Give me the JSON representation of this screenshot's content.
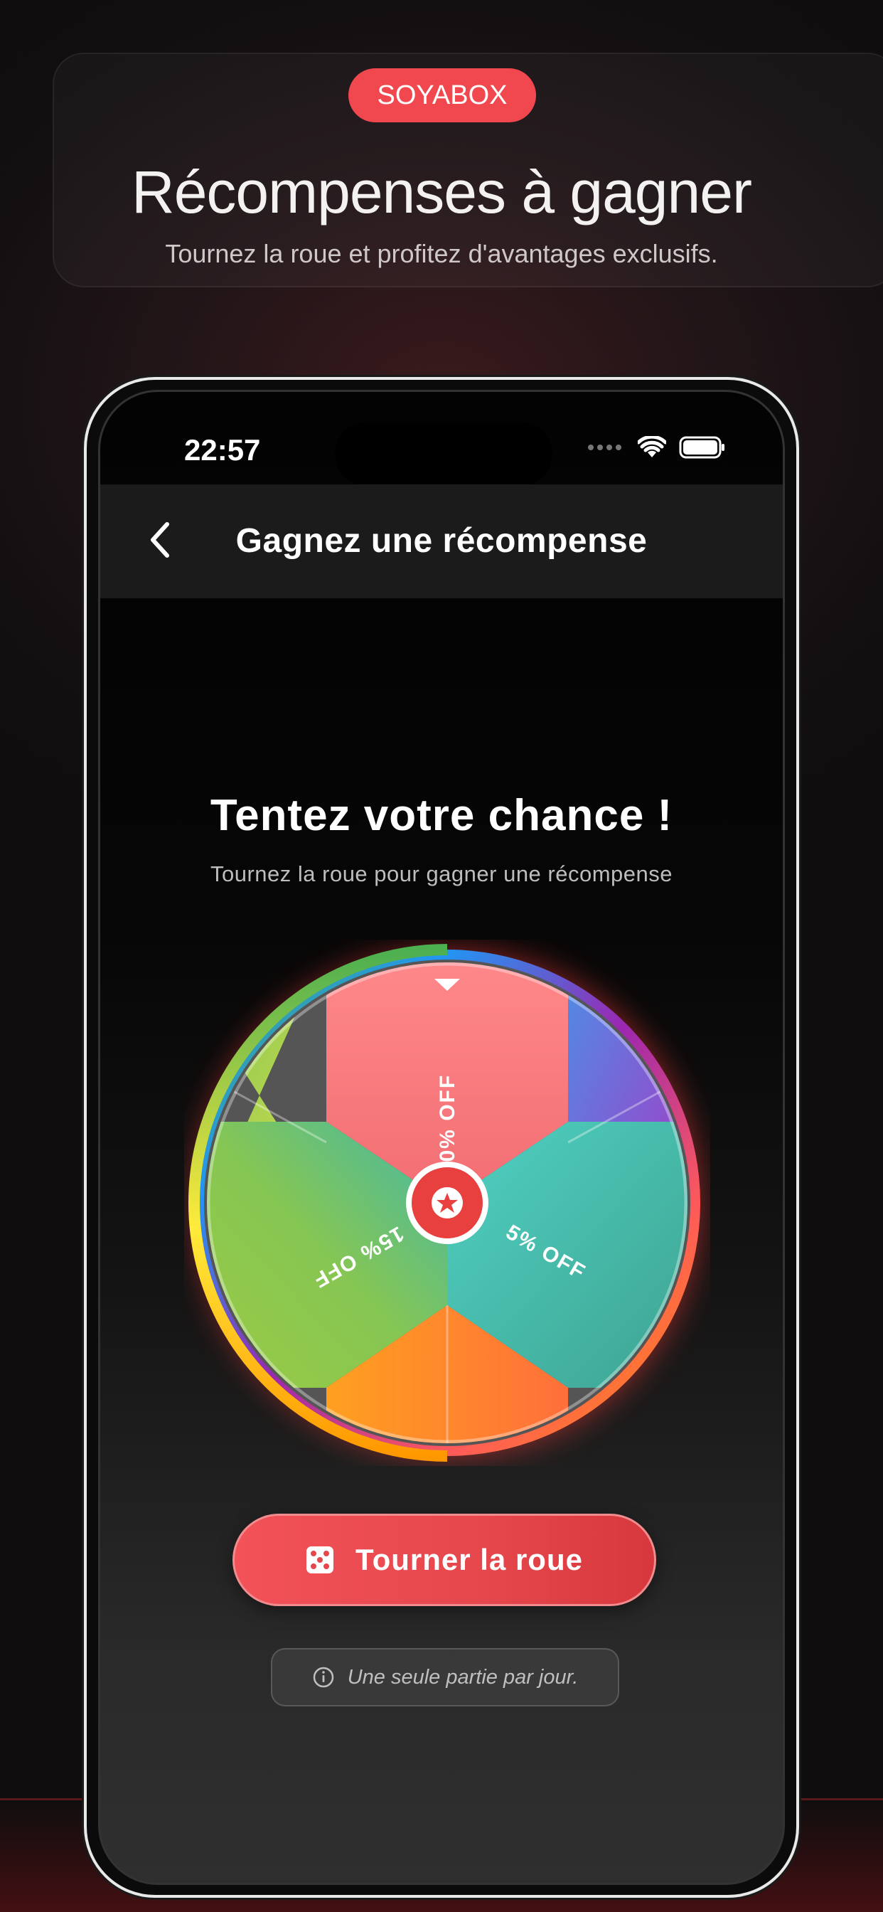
{
  "promo": {
    "brand": "SOYABOX",
    "title": "Récompenses à gagner",
    "subtitle": "Tournez la roue et profitez d'avantages exclusifs."
  },
  "status_bar": {
    "time": "22:57",
    "icons": [
      "signal-icon",
      "wifi-icon",
      "battery-icon"
    ]
  },
  "header": {
    "back_icon": "chevron-left-icon",
    "title": "Gagnez une récompense"
  },
  "game": {
    "title": "Tentez votre chance !",
    "subtitle": "Tournez la roue pour gagner une récompense",
    "wheel": {
      "segments": [
        "10% OFF",
        "5% OFF",
        "15% OFF"
      ],
      "center_icon": "star-icon",
      "pointer_icon": "triangle-down-icon"
    },
    "spin_button": {
      "label": "Tourner la roue",
      "icon": "dice-icon"
    },
    "info": {
      "icon": "info-icon",
      "text": "Une seule partie par jour."
    }
  },
  "colors": {
    "accent": "#f0484e",
    "segment_top": "#f27a7c",
    "segment_right": "#4fc3b6",
    "segment_left": "#8bc34a"
  }
}
